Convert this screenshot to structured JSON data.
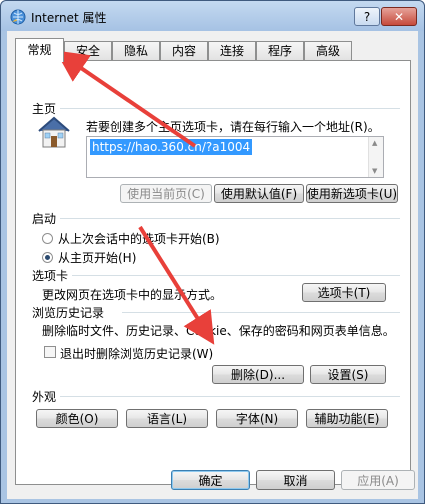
{
  "window": {
    "title": "Internet 属性",
    "help_label": "?",
    "close_label": "✕"
  },
  "tabs": [
    "常规",
    "安全",
    "隐私",
    "内容",
    "连接",
    "程序",
    "高级"
  ],
  "homepage": {
    "label": "主页",
    "description": "若要创建多个主页选项卡，请在每行输入一个地址(R)。",
    "url": "https://hao.360.cn/?a1004",
    "use_current": "使用当前页(C)",
    "use_default": "使用默认值(F)",
    "use_new_tab": "使用新选项卡(U)"
  },
  "startup": {
    "label": "启动",
    "option_last_session": "从上次会话中的选项卡开始(B)",
    "option_homepage": "从主页开始(H)",
    "selected": "option_homepage"
  },
  "tabs_section": {
    "label": "选项卡",
    "description": "更改网页在选项卡中的显示方式。",
    "button": "选项卡(T)"
  },
  "history": {
    "label": "浏览历史记录",
    "description": "删除临时文件、历史记录、Cookie、保存的密码和网页表单信息。",
    "delete_on_exit": "退出时删除浏览历史记录(W)",
    "delete_on_exit_checked": false,
    "delete_button": "删除(D)...",
    "settings_button": "设置(S)"
  },
  "appearance": {
    "label": "外观",
    "colors": "颜色(O)",
    "languages": "语言(L)",
    "fonts": "字体(N)",
    "accessibility": "辅助功能(E)"
  },
  "footer": {
    "ok": "确定",
    "cancel": "取消",
    "apply": "应用(A)"
  },
  "colors": {
    "annotation_arrow": "#e8403a",
    "selection": "#3399ff"
  }
}
